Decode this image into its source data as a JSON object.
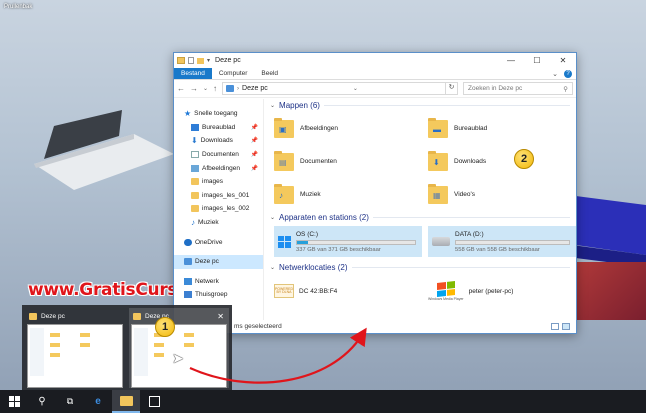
{
  "desktop": {
    "label": "Prullenbak"
  },
  "watermark": "www.GratisCursus.be",
  "explorer": {
    "title": "Deze pc",
    "ribbon_tabs": [
      {
        "label": "Bestand",
        "active": true
      },
      {
        "label": "Computer",
        "active": false
      },
      {
        "label": "Beeld",
        "active": false
      }
    ],
    "address": "Deze pc",
    "search_placeholder": "Zoeken in Deze pc",
    "nav_items": [
      {
        "label": "Snelle toegang",
        "icon": "star-icon",
        "group": true
      },
      {
        "label": "Bureaublad",
        "icon": "desktop-icon",
        "pinned": true
      },
      {
        "label": "Downloads",
        "icon": "download-icon",
        "pinned": true
      },
      {
        "label": "Documenten",
        "icon": "documents-icon",
        "pinned": true
      },
      {
        "label": "Afbeeldingen",
        "icon": "pictures-icon",
        "pinned": true
      },
      {
        "label": "images",
        "icon": "folder-icon"
      },
      {
        "label": "images_les_001",
        "icon": "folder-icon"
      },
      {
        "label": "images_les_002",
        "icon": "folder-icon"
      },
      {
        "label": "Muziek",
        "icon": "music-icon"
      },
      {
        "label": "OneDrive",
        "icon": "cloud-icon",
        "group": true
      },
      {
        "label": "Deze pc",
        "icon": "pc-icon",
        "group": true,
        "selected": true
      },
      {
        "label": "Netwerk",
        "icon": "network-icon",
        "group": true
      },
      {
        "label": "Thuisgroep",
        "icon": "homegroup-icon",
        "group": true
      }
    ],
    "folders_header": "Mappen (6)",
    "folders": [
      {
        "label": "Afbeeldingen",
        "icon": "pictures-folder-icon"
      },
      {
        "label": "Bureaublad",
        "icon": "desktop-folder-icon"
      },
      {
        "label": "Documenten",
        "icon": "documents-folder-icon"
      },
      {
        "label": "Downloads",
        "icon": "downloads-folder-icon"
      },
      {
        "label": "Muziek",
        "icon": "music-folder-icon"
      },
      {
        "label": "Video's",
        "icon": "videos-folder-icon"
      }
    ],
    "drives_header": "Apparaten en stations (2)",
    "drives": [
      {
        "label": "OS (C:)",
        "free": "337 GB van 371 GB beschikbaar",
        "used_fraction": 0.09,
        "icon": "windows-drive-icon"
      },
      {
        "label": "DATA (D:)",
        "free": "558 GB van 558 GB beschikbaar",
        "used_fraction": 0.0,
        "icon": "disk-drive-icon"
      }
    ],
    "network_header": "Netwerklocaties (2)",
    "network": [
      {
        "label": "DC 42:BB:F4",
        "icon_text": "POWERED BY DLNA",
        "icon": "media-server-icon"
      },
      {
        "label": "peter (peter-pc)",
        "icon_text": "Windows Media Player",
        "icon": "windows-media-icon"
      }
    ],
    "status": "ms geselecteerd"
  },
  "flyout": {
    "thumbs": [
      {
        "title": "Deze pc",
        "hover": false
      },
      {
        "title": "Deze pc",
        "hover": true
      }
    ]
  },
  "badges": {
    "one": "1",
    "two": "2"
  },
  "colors": {
    "accent": "#1979ca",
    "selection": "#cce8ff",
    "watermark": "#e0151b",
    "taskbar": "#1a1c21"
  }
}
